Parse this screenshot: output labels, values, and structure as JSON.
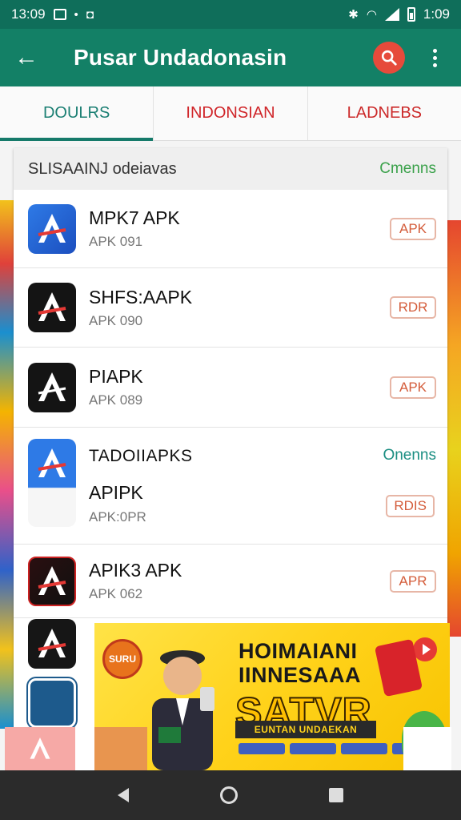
{
  "status_bar": {
    "time_left": "13:09",
    "time_right": "1:09"
  },
  "app_bar": {
    "title": "Pusar Undadonasin"
  },
  "tabs": [
    {
      "label": "DOULRS",
      "active": true
    },
    {
      "label": "INDONSIAN",
      "active": false
    },
    {
      "label": "LADNEBS",
      "active": false
    }
  ],
  "list_header": {
    "title": "SLISAAINJ odeiavas",
    "link": "Cmenns"
  },
  "apps": [
    {
      "name": "MPK7 APK",
      "sub": "APK 091",
      "badge": "APK"
    },
    {
      "name": "SHFS:AAPK",
      "sub": "APK 090",
      "badge": "RDR"
    },
    {
      "name": "PIAPK",
      "sub": "APK 089",
      "badge": "APK"
    }
  ],
  "section2": {
    "title": "TADOIIAPKS",
    "link": "Onenns",
    "name": "APIPK",
    "sub": "APK:0PR",
    "badge": "RDIS"
  },
  "app_row5": {
    "name": "APIK3 APK",
    "sub": "APK 062",
    "badge": "APR"
  },
  "ad": {
    "line1": "HOIMAIANI",
    "line2": "IINNESAAA",
    "line3": "SATVR",
    "strip": "EUNTAN UNDAEKAN",
    "badge": "SURU"
  },
  "colors": {
    "primary": "#138066",
    "accent_red": "#e64a3b",
    "link_green": "#3aa14a"
  }
}
